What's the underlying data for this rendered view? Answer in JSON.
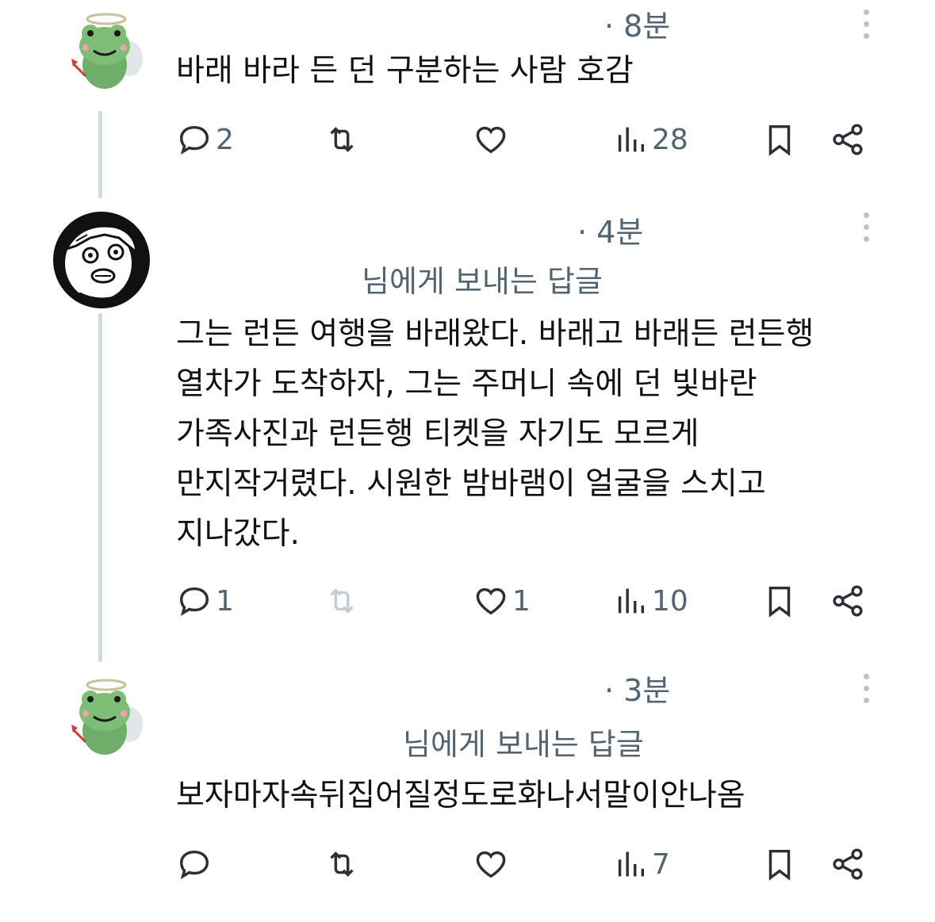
{
  "posts": [
    {
      "time": "· 8분",
      "reply_to": "",
      "text": "바래 바라 든 던 구분하는 사람 호감",
      "avatar": "frog-angel-avatar",
      "stats": {
        "replies": "2",
        "reposts": "",
        "likes": "",
        "views": "28"
      }
    },
    {
      "time": "· 4분",
      "reply_to": "님에게 보내는 답글",
      "text": "그는 런든 여행을 바래왔다. 바래고 바래든 런든행\n열차가 도착하자, 그는 주머니 속에 던 빛바란\n가족사진과 런든행 티켓을 자기도 모르게\n만지작거렸다. 시원한 밤바램이 얼굴을 스치고\n지나갔다.",
      "avatar": "manga-character-avatar",
      "stats": {
        "replies": "1",
        "reposts": "",
        "likes": "1",
        "views": "10"
      }
    },
    {
      "time": "· 3분",
      "reply_to": "님에게 보내는 답글",
      "text": "보자마자속뒤집어질정도로화나서말이안나옴",
      "avatar": "frog-angel-avatar",
      "stats": {
        "replies": "",
        "reposts": "",
        "likes": "",
        "views": "7"
      }
    }
  ],
  "icons": {
    "reply": "reply-icon",
    "repost": "repost-icon",
    "like": "heart-icon",
    "views": "views-icon",
    "bookmark": "bookmark-icon",
    "share": "share-icon",
    "more": "more-vertical-icon"
  },
  "colors": {
    "text": "#0f1419",
    "muted": "#536471",
    "thread_line": "#cfd9de"
  }
}
